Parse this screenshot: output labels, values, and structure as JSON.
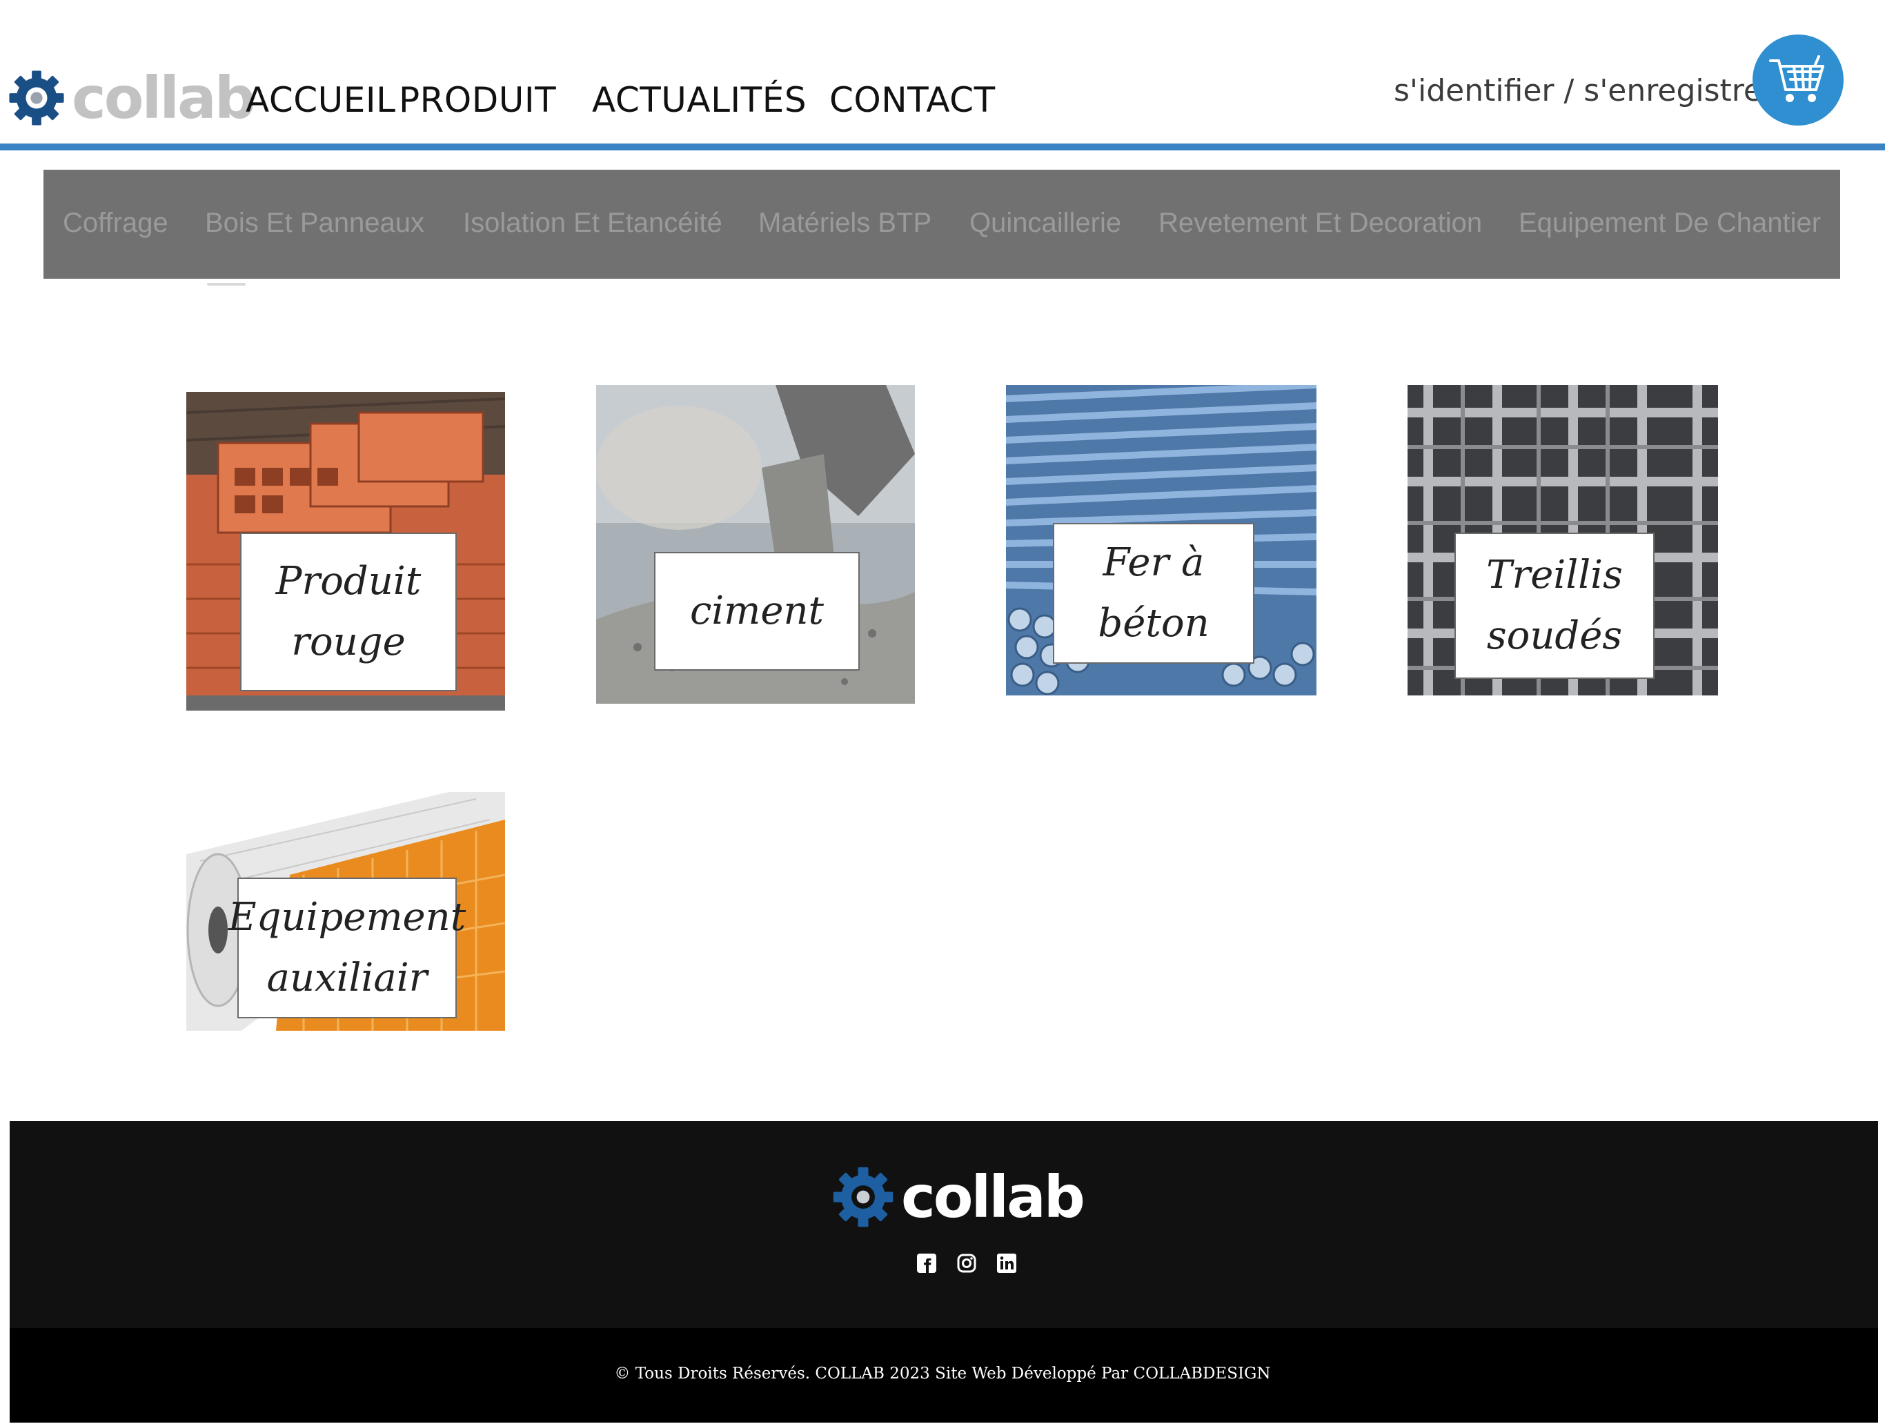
{
  "header": {
    "logo_text": "collab",
    "nav": [
      "ACCUEIL",
      "PRODUIT",
      "ACTUALITÉS",
      "CONTACT"
    ],
    "auth_link": "s'identifier / s'enregistrer",
    "cart_icon": "cart-icon",
    "accent_color": "#3a83c4"
  },
  "categories": [
    "Coffrage",
    "Bois Et Panneaux",
    "Isolation Et Etancéité",
    "Matériels BTP",
    "Quincaillerie",
    "Revetement Et Decoration",
    "Equipement De Chantier"
  ],
  "products": [
    {
      "line1": "Produit",
      "line2": "rouge"
    },
    {
      "line1": "ciment",
      "line2": ""
    },
    {
      "line1": "Fer à",
      "line2": "béton"
    },
    {
      "line1": "Treillis",
      "line2": "soudés"
    },
    {
      "line1": "Equipement",
      "line2": "auxiliair"
    }
  ],
  "footer": {
    "logo_text": "collab",
    "social_icons": [
      "facebook-icon",
      "instagram-icon",
      "linkedin-icon"
    ],
    "copyright": "© Tous Droits Réservés. COLLAB 2023 Site Web Développé Par COLLABDESIGN"
  }
}
